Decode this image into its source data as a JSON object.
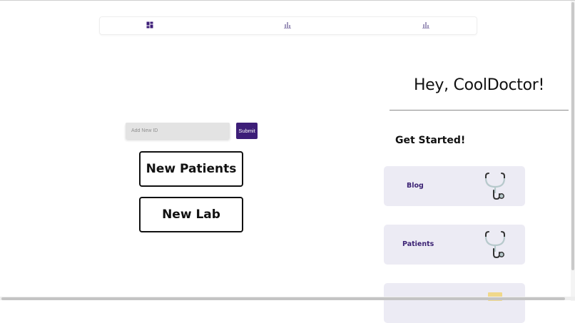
{
  "nav": {
    "items": [
      {
        "icon": "dashboard-icon"
      },
      {
        "icon": "bar-chart-icon"
      },
      {
        "icon": "bar-chart-icon"
      }
    ],
    "active_color": "#3d1e78",
    "inactive_color": "#a49bbf"
  },
  "greeting": "Hey, CoolDoctor!",
  "get_started": "Get Started!",
  "form": {
    "id_placeholder": "Add New ID",
    "submit_label": "Submit"
  },
  "buttons": {
    "new_patients": "New Patients",
    "new_lab": "New Lab"
  },
  "cards": [
    {
      "label": "Blog",
      "icon": "stethoscope-icon"
    },
    {
      "label": "Patients",
      "icon": "stethoscope-icon"
    },
    {
      "label": "",
      "icon": "note-icon"
    }
  ],
  "colors": {
    "accent": "#3d1e78",
    "card_bg": "#ecebf4",
    "input_bg": "#e3e3e3"
  }
}
